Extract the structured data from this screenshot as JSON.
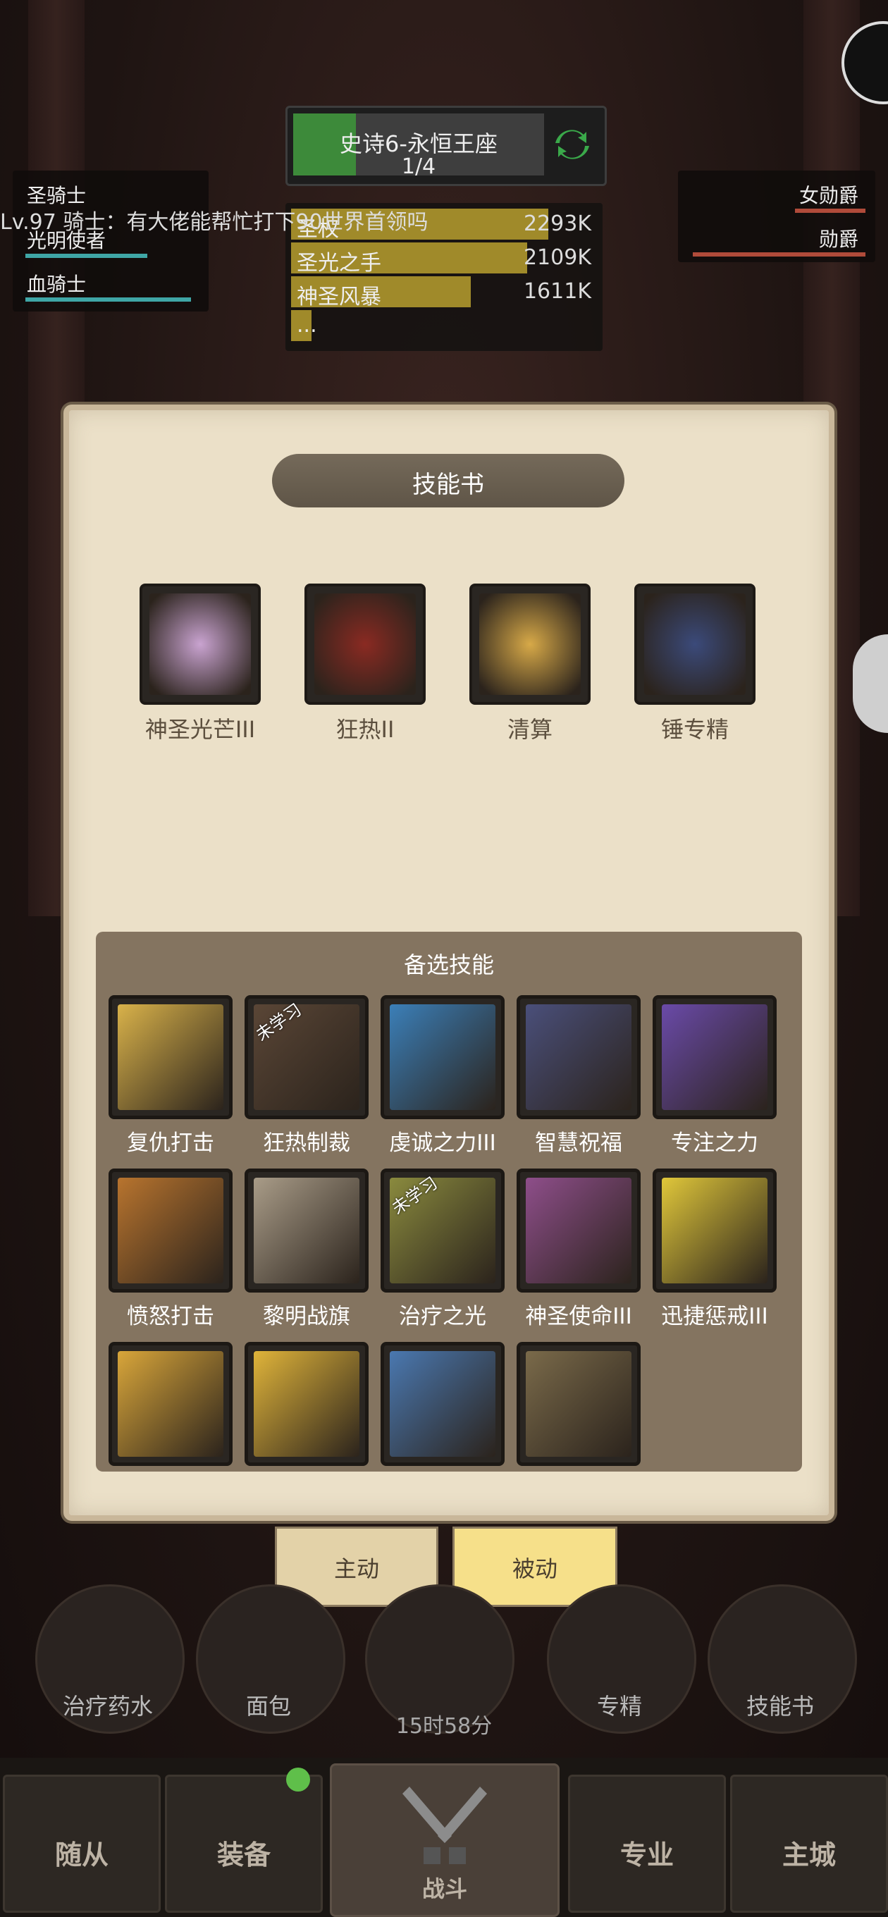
{
  "boss": {
    "name": "史诗6-永恒王座",
    "progress": "1/4",
    "progress_fraction": 0.25
  },
  "damage_meter": [
    {
      "name": "圣权",
      "value": "2293K",
      "fraction": 1.0
    },
    {
      "name": "圣光之手",
      "value": "2109K",
      "fraction": 0.92
    },
    {
      "name": "神圣风暴",
      "value": "1611K",
      "fraction": 0.7
    },
    {
      "name": "...",
      "value": "",
      "fraction": 0.08
    }
  ],
  "party_left": [
    {
      "name": "圣骑士",
      "hp": 0.0
    },
    {
      "name": "光明使者",
      "hp": 0.75
    },
    {
      "name": "血骑士",
      "hp": 0.98
    }
  ],
  "party_right": [
    {
      "name": "女勋爵",
      "hp": 0.4
    },
    {
      "name": "勋爵",
      "hp": 0.98
    }
  ],
  "chat": "Lv.97 骑士：有大佬能帮忙打下90世界首领吗",
  "dialog": {
    "title": "技能书",
    "equipped": [
      {
        "label": "神圣光芒III",
        "icon": "holy-radiance-icon",
        "color": "#c9a3d0"
      },
      {
        "label": "狂热II",
        "icon": "zeal-icon",
        "color": "#8a2a22"
      },
      {
        "label": "清算",
        "icon": "reckoning-fist-icon",
        "color": "#d7a948"
      },
      {
        "label": "锤专精",
        "icon": "hammer-mastery-icon",
        "color": "#3b4a7a"
      }
    ],
    "alt_title": "备选技能",
    "alt_skills": [
      {
        "label": "复仇打击",
        "icon": "vengeance-strike-icon",
        "color": "#d9b24a",
        "unlearned": false
      },
      {
        "label": "狂热制裁",
        "icon": "zealous-judgment-icon",
        "color": "#5a4636",
        "unlearned": true
      },
      {
        "label": "虔诚之力III",
        "icon": "devotion-shield-icon",
        "color": "#3b7fb8",
        "unlearned": false
      },
      {
        "label": "智慧祝福",
        "icon": "wisdom-blessing-icon",
        "color": "#4a4f7a",
        "unlearned": false
      },
      {
        "label": "专注之力",
        "icon": "focus-power-icon",
        "color": "#6a4aa8",
        "unlearned": false
      },
      {
        "label": "愤怒打击",
        "icon": "wrath-strike-icon",
        "color": "#b8742e",
        "unlearned": false
      },
      {
        "label": "黎明战旗",
        "icon": "dawn-banner-icon",
        "color": "#a99c88",
        "unlearned": false
      },
      {
        "label": "治疗之光",
        "icon": "healing-light-icon",
        "color": "#8a8a3e",
        "unlearned": true
      },
      {
        "label": "神圣使命III",
        "icon": "holy-mission-icon",
        "color": "#8e4e8a",
        "unlearned": false
      },
      {
        "label": "迅捷惩戒III",
        "icon": "swift-retribution-icon",
        "color": "#e0c73a",
        "unlearned": false
      },
      {
        "label": "",
        "icon": "holy-hand-icon",
        "color": "#d9a63a",
        "unlearned": false
      },
      {
        "label": "",
        "icon": "lightning-smite-icon",
        "color": "#e0b43a",
        "unlearned": false
      },
      {
        "label": "",
        "icon": "shield-bash-icon",
        "color": "#4a78b0",
        "unlearned": false
      },
      {
        "label": "",
        "icon": "holy-wave-icon",
        "color": "#7a6a4a",
        "unlearned": false
      }
    ],
    "unlearned_text": "未学习"
  },
  "tabs": {
    "active": "主动",
    "passive": "被动"
  },
  "actions": [
    {
      "label": "治疗药水",
      "icon": "potion-icon"
    },
    {
      "label": "面包",
      "icon": "bread-icon"
    },
    {
      "label": "",
      "icon": "chest-icon"
    },
    {
      "label": "专精",
      "icon": "specialization-icon"
    },
    {
      "label": "技能书",
      "icon": "skill-book-icon"
    }
  ],
  "timer": "15时58分",
  "nav": {
    "followers": "随从",
    "equipment": "装备",
    "battle": "战斗",
    "profession": "专业",
    "city": "主城"
  }
}
